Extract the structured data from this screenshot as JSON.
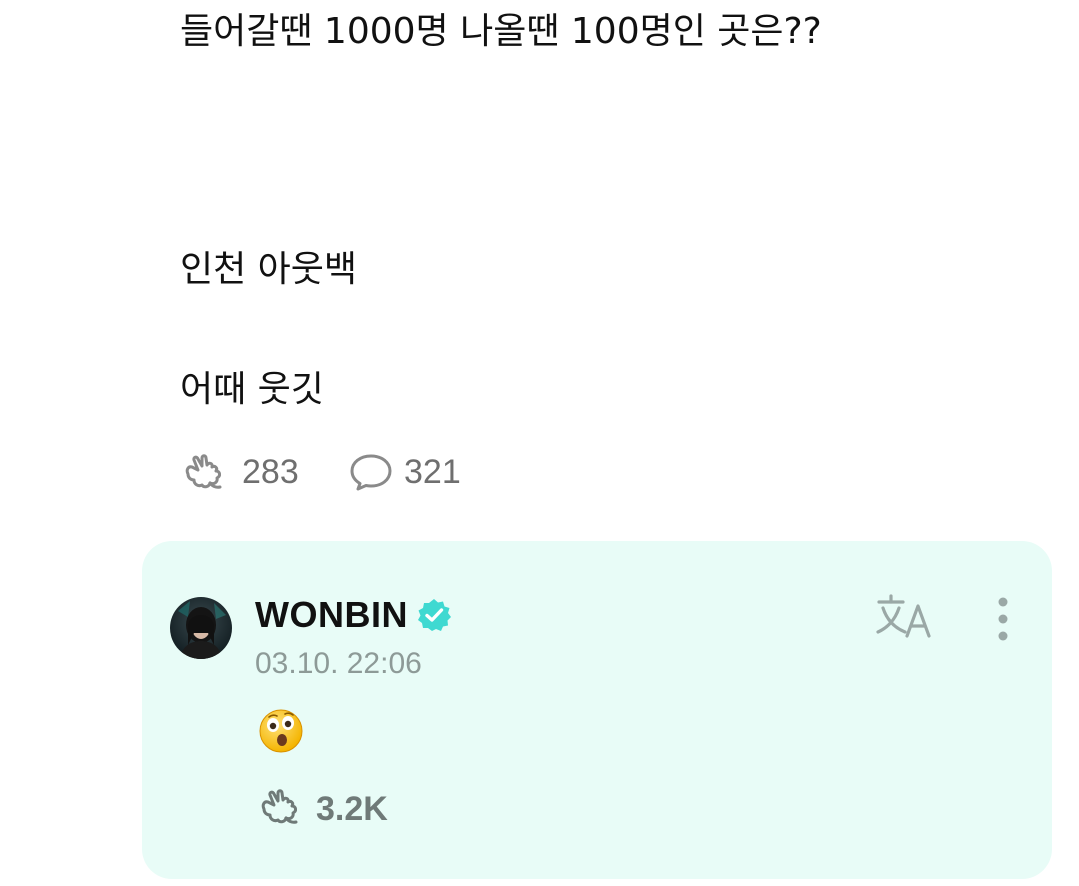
{
  "post": {
    "lines": [
      "들어갈땐 1000명 나올땐 100명인 곳은??",
      "인천 아웃백",
      "어때 웃깃"
    ],
    "stats": {
      "likes": "283",
      "comments": "321"
    }
  },
  "reply": {
    "author": "WONBIN",
    "verified": true,
    "timestamp": "03.10. 22:06",
    "content_emoji": "astonished-face",
    "likes": "3.2K"
  },
  "icons": {
    "like": "like-hand-icon",
    "comment": "comment-bubble-icon",
    "verified": "verified-badge-icon",
    "translate": "translate-icon",
    "more": "more-vertical-icon"
  },
  "colors": {
    "reply_background": "#e8fcf7",
    "verified_badge": "#3fd9d1",
    "icon_gray": "#8a8a8a",
    "muted_text": "#8d9a97"
  }
}
